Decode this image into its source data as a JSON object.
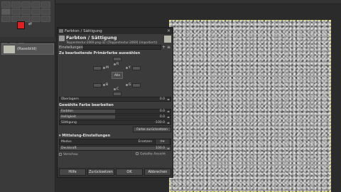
{
  "toolbox": {
    "layer_name": "(Rasebild)"
  },
  "dialog": {
    "window_title": "Farbton / Sättigung",
    "header_title": "Farbton / Sättigung",
    "header_subtitle": "Teppentextur-2069.png-32 ([Teppentextur-2069] (importiert))",
    "presets_label": "Einstellungen:",
    "section_primary": "Zu bearbeitende Primärfarbe auswählen",
    "hue_labels": [
      "R",
      "G",
      "Y",
      "C",
      "M",
      "B"
    ],
    "all_button": "Alle",
    "overlap": {
      "label": "Überlagern",
      "value": "0.0"
    },
    "section_edit": "Gewählte Farbe bearbeiten",
    "hue": {
      "label": "Farbton",
      "value": "0.0"
    },
    "lightness": {
      "label": "Helligkeit",
      "value": "0.0"
    },
    "saturation": {
      "label": "Sättigung",
      "value": "-100.0",
      "fill_fraction": 0.0
    },
    "reset_color": "Farbe zurücksetzen",
    "section_blend": "Mittelung-Einstellungen",
    "mode_label": "Modus",
    "mode_value": "Ersetzen",
    "opacity_label": "Deckkraft",
    "opacity_value": "100.0",
    "preview_label": "Vorschau",
    "split_label": "Geteilte Ansicht",
    "buttons": {
      "help": "Hilfe",
      "reset": "Zurücksetzen",
      "ok": "OK",
      "cancel": "Abbrechen"
    }
  }
}
